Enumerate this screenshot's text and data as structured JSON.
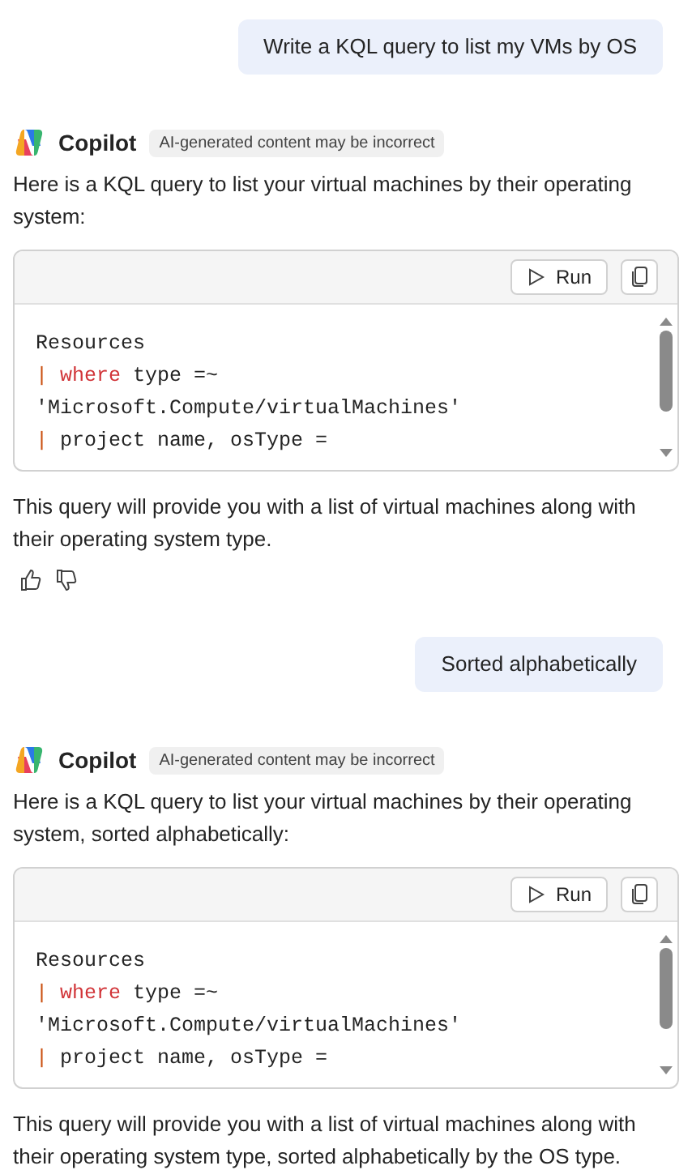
{
  "messages": [
    {
      "kind": "user",
      "text": "Write a KQL query to list my VMs by OS"
    },
    {
      "kind": "assistant",
      "sender": "Copilot",
      "badge": "AI-generated content may be incorrect",
      "intro": "Here is a KQL query to list your virtual machines by their operating system:",
      "run_label": "Run",
      "code_lines": [
        [
          {
            "kind": "plain",
            "text": "Resources"
          }
        ],
        [
          {
            "kind": "pipe",
            "text": "|"
          },
          {
            "kind": "keyword",
            "text": "where"
          },
          {
            "kind": "plain",
            "text": "type =~"
          }
        ],
        [
          {
            "kind": "string",
            "text": "'Microsoft.Compute/virtualMachines'"
          }
        ],
        [
          {
            "kind": "pipe",
            "text": "|"
          },
          {
            "kind": "plain",
            "text": "project name, osType ="
          }
        ]
      ],
      "outro": "This query will provide you with a list of virtual machines along with their operating system type.",
      "feedback": true
    },
    {
      "kind": "user",
      "text": "Sorted alphabetically"
    },
    {
      "kind": "assistant",
      "sender": "Copilot",
      "badge": "AI-generated content may be incorrect",
      "intro": "Here is a KQL query to list your virtual machines by their operating system, sorted alphabetically:",
      "run_label": "Run",
      "code_lines": [
        [
          {
            "kind": "plain",
            "text": "Resources"
          }
        ],
        [
          {
            "kind": "pipe",
            "text": "|"
          },
          {
            "kind": "keyword",
            "text": "where"
          },
          {
            "kind": "plain",
            "text": "type =~"
          }
        ],
        [
          {
            "kind": "string",
            "text": "'Microsoft.Compute/virtualMachines'"
          }
        ],
        [
          {
            "kind": "pipe",
            "text": "|"
          },
          {
            "kind": "plain",
            "text": "project name, osType ="
          }
        ]
      ],
      "outro": "This query will provide you with a list of virtual machines along with their operating system type, sorted alphabetically by the OS type.",
      "feedback": false
    }
  ]
}
